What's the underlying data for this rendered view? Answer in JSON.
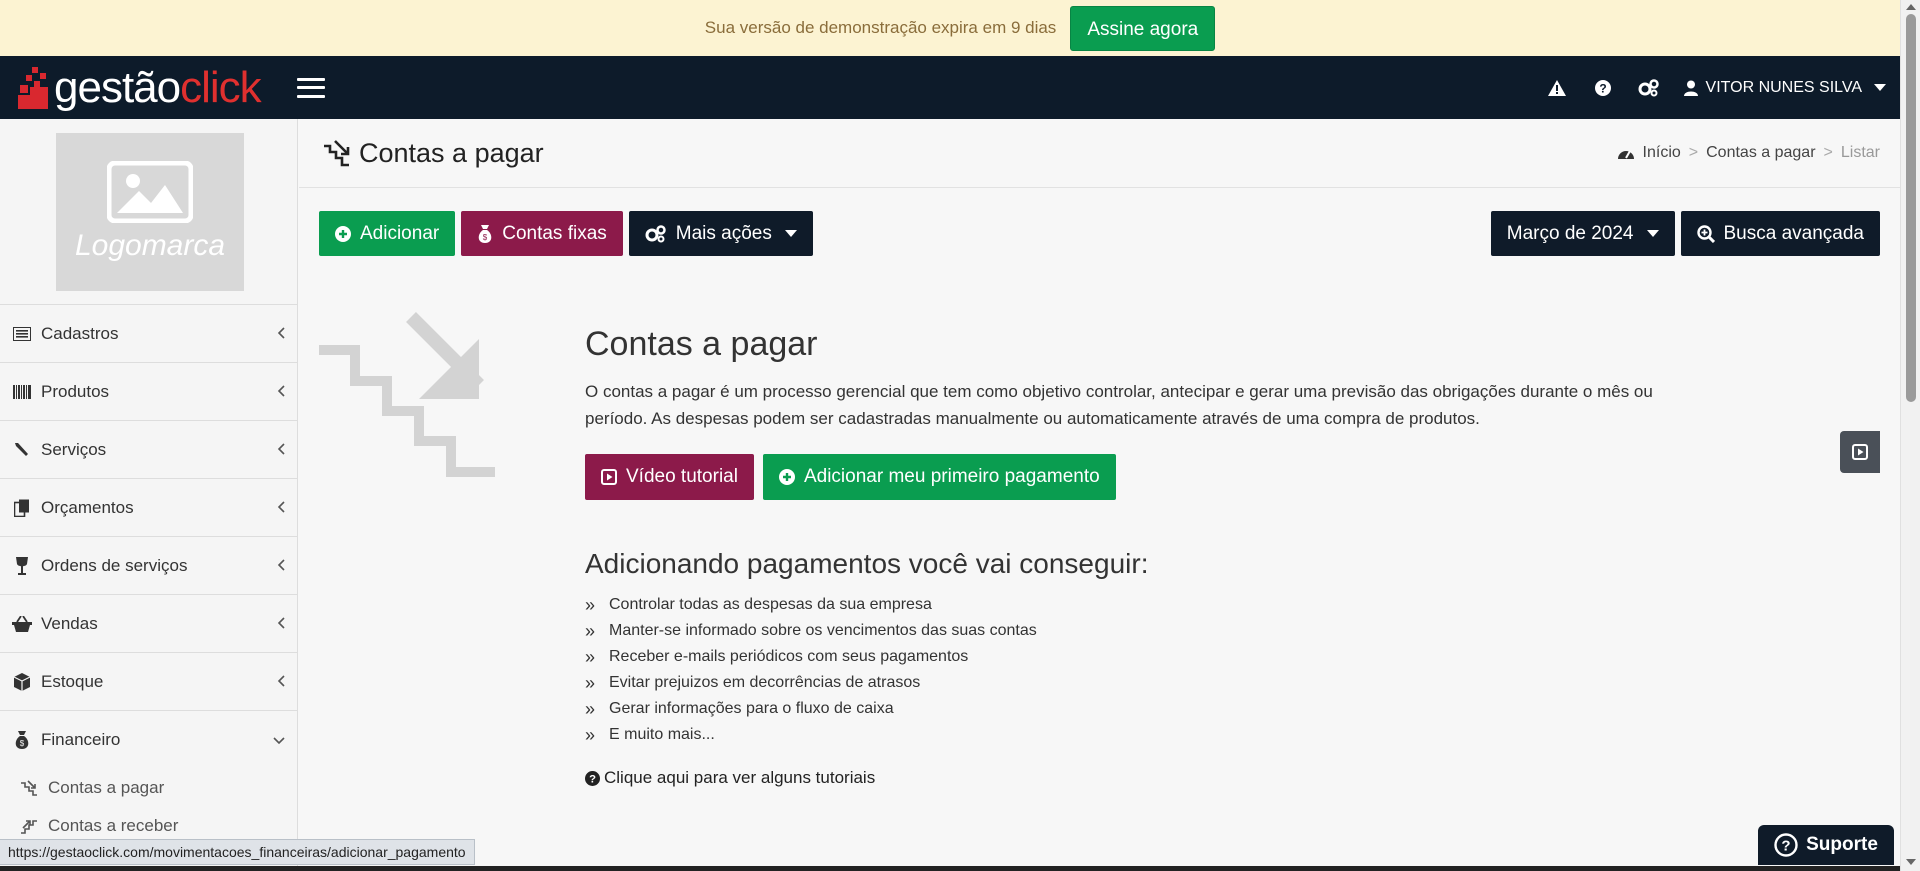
{
  "demo_banner": {
    "text": "Sua versão de demonstração expira em 9 dias",
    "button": "Assine agora"
  },
  "brand": {
    "part1": "gestão",
    "part2": "click",
    "colors": {
      "navbar": "#0d1b2a",
      "red": "#e0302f",
      "green": "#0a9d50",
      "wine": "#8c1a4a"
    }
  },
  "topnav": {
    "icons": [
      "warning-icon",
      "help-icon",
      "settings-icon"
    ],
    "user": "VITOR NUNES SILVA"
  },
  "sidebar": {
    "logo_placeholder": "Logomarca",
    "items": [
      {
        "label": "Cadastros",
        "icon": "list-icon"
      },
      {
        "label": "Produtos",
        "icon": "barcode-icon"
      },
      {
        "label": "Serviços",
        "icon": "wrench-icon"
      },
      {
        "label": "Orçamentos",
        "icon": "copy-icon"
      },
      {
        "label": "Ordens de serviços",
        "icon": "wineglass-icon"
      },
      {
        "label": "Vendas",
        "icon": "basket-icon"
      },
      {
        "label": "Estoque",
        "icon": "cube-icon"
      },
      {
        "label": "Financeiro",
        "icon": "moneybag-icon",
        "expanded": true
      }
    ],
    "sub_items": [
      {
        "label": "Contas a pagar",
        "icon": "stairs-down-icon"
      },
      {
        "label": "Contas a receber",
        "icon": "stairs-up-icon"
      }
    ]
  },
  "page": {
    "title": "Contas a pagar",
    "breadcrumb": [
      "Início",
      "Contas a pagar",
      "Listar"
    ]
  },
  "toolbar": {
    "add": "Adicionar",
    "fixed": "Contas fixas",
    "more": "Mais ações",
    "month": "Março de 2024",
    "search": "Busca avançada"
  },
  "content": {
    "heading": "Contas a pagar",
    "description": "O contas a pagar é um processo gerencial que tem como objetivo controlar, antecipar e gerar uma previsão das obrigações durante o mês ou período. As despesas podem ser cadastradas manualmente ou automaticamente através de uma compra de produtos.",
    "video_button": "Vídeo tutorial",
    "first_payment_button": "Adicionar meu primeiro pagamento",
    "benefits_heading": "Adicionando pagamentos você vai conseguir:",
    "benefits": [
      "Controlar todas as despesas da sua empresa",
      "Manter-se informado sobre os vencimentos das suas contas",
      "Receber e-mails periódicos com seus pagamentos",
      "Evitar prejuizos em decorrências de atrasos",
      "Gerar informações para o fluxo de caixa",
      "E muito mais..."
    ],
    "help_link": "Clique aqui para ver alguns tutoriais"
  },
  "status_url": "https://gestaoclick.com/movimentacoes_financeiras/adicionar_pagamento",
  "support": "Suporte"
}
